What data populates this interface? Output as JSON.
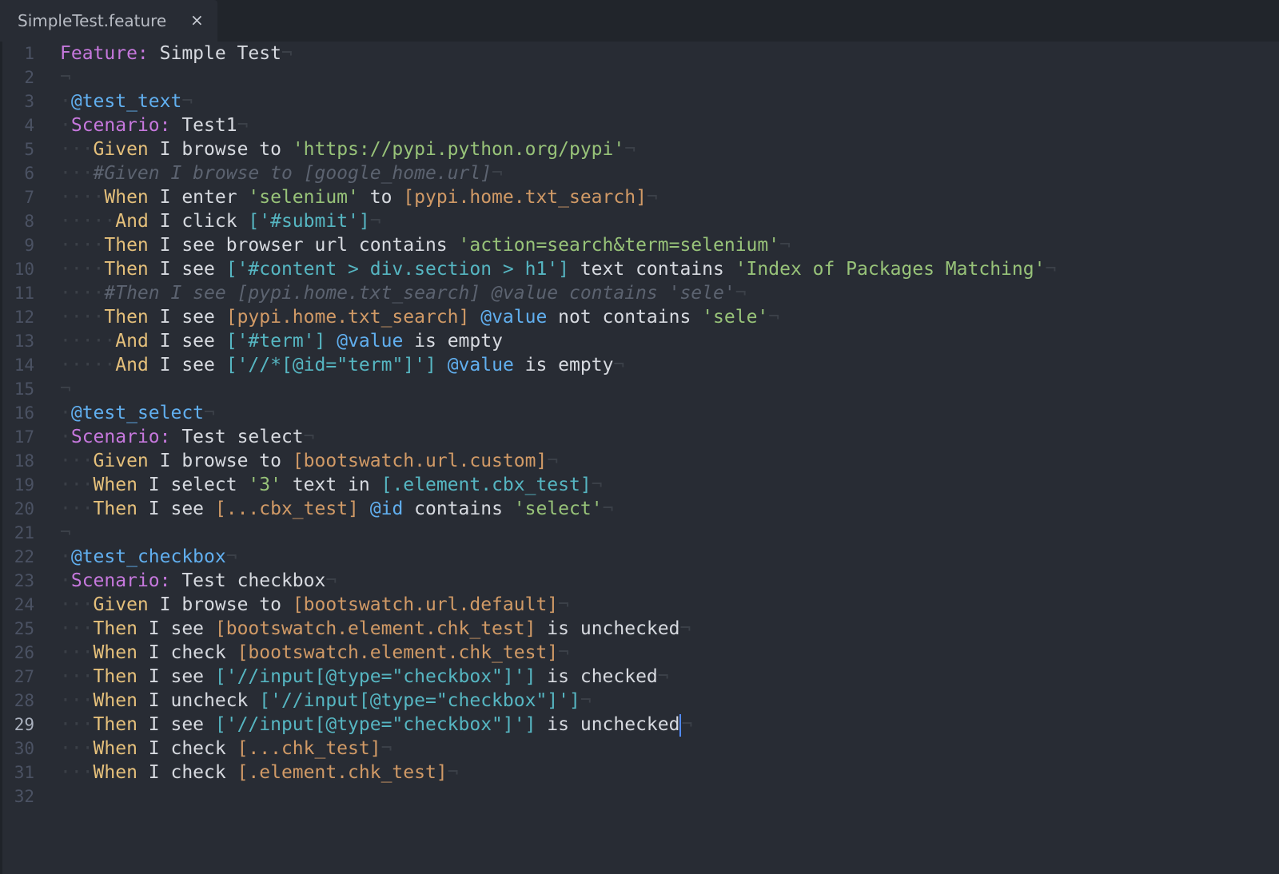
{
  "tab": {
    "title": "SimpleTest.feature",
    "close_glyph": "×"
  },
  "cursor": {
    "line": 29
  },
  "lines": [
    {
      "n": "1",
      "segs": [
        [
          "kw-feature",
          "Feature:"
        ],
        [
          "txt",
          " Simple Test"
        ],
        [
          "ws",
          "¬"
        ]
      ]
    },
    {
      "n": "2",
      "segs": [
        [
          "ws",
          "¬"
        ]
      ]
    },
    {
      "n": "3",
      "segs": [
        [
          "ws",
          "·"
        ],
        [
          "tag",
          "@test_text"
        ],
        [
          "ws",
          "¬"
        ]
      ]
    },
    {
      "n": "4",
      "segs": [
        [
          "ws",
          "·"
        ],
        [
          "kw-scenario",
          "Scenario:"
        ],
        [
          "txt",
          " Test1"
        ],
        [
          "ws",
          "¬"
        ]
      ]
    },
    {
      "n": "5",
      "segs": [
        [
          "ws",
          "···"
        ],
        [
          "kw-step",
          "Given"
        ],
        [
          "txt",
          " I browse to "
        ],
        [
          "str",
          "'https://pypi.python.org/pypi'"
        ],
        [
          "ws",
          "¬"
        ]
      ]
    },
    {
      "n": "6",
      "segs": [
        [
          "ws",
          "···"
        ],
        [
          "comment",
          "#Given I browse to [google_home.url]"
        ],
        [
          "ws",
          "¬"
        ]
      ]
    },
    {
      "n": "7",
      "segs": [
        [
          "ws",
          "····"
        ],
        [
          "kw-step",
          "When"
        ],
        [
          "txt",
          " I enter "
        ],
        [
          "str",
          "'selenium'"
        ],
        [
          "txt",
          " to "
        ],
        [
          "loc",
          "[pypi.home.txt_search]"
        ],
        [
          "ws",
          "¬"
        ]
      ]
    },
    {
      "n": "8",
      "segs": [
        [
          "ws",
          "·····"
        ],
        [
          "kw-step",
          "And"
        ],
        [
          "txt",
          " I click "
        ],
        [
          "sel",
          "['#submit']"
        ],
        [
          "ws",
          "¬"
        ]
      ]
    },
    {
      "n": "9",
      "segs": [
        [
          "ws",
          "····"
        ],
        [
          "kw-step",
          "Then"
        ],
        [
          "txt",
          " I see browser url contains "
        ],
        [
          "str",
          "'action=search&term=selenium'"
        ],
        [
          "ws",
          "¬"
        ]
      ]
    },
    {
      "n": "10",
      "segs": [
        [
          "ws",
          "····"
        ],
        [
          "kw-step",
          "Then"
        ],
        [
          "txt",
          " I see "
        ],
        [
          "sel",
          "['#content > div.section > h1']"
        ],
        [
          "txt",
          " text contains "
        ],
        [
          "str",
          "'Index of Packages Matching'"
        ],
        [
          "ws",
          "¬"
        ]
      ]
    },
    {
      "n": "11",
      "segs": [
        [
          "ws",
          "····"
        ],
        [
          "comment",
          "#Then I see [pypi.home.txt_search] @value contains 'sele'"
        ],
        [
          "ws",
          "¬"
        ]
      ]
    },
    {
      "n": "12",
      "segs": [
        [
          "ws",
          "····"
        ],
        [
          "kw-step",
          "Then"
        ],
        [
          "txt",
          " I see "
        ],
        [
          "loc",
          "[pypi.home.txt_search]"
        ],
        [
          "txt",
          " "
        ],
        [
          "attr",
          "@value"
        ],
        [
          "txt",
          " not contains "
        ],
        [
          "str",
          "'sele'"
        ],
        [
          "ws",
          "¬"
        ]
      ]
    },
    {
      "n": "13",
      "segs": [
        [
          "ws",
          "·····"
        ],
        [
          "kw-step",
          "And"
        ],
        [
          "txt",
          " I see "
        ],
        [
          "sel",
          "['#term']"
        ],
        [
          "txt",
          " "
        ],
        [
          "attr",
          "@value"
        ],
        [
          "txt",
          " is empty"
        ]
      ]
    },
    {
      "n": "14",
      "segs": [
        [
          "ws",
          "·····"
        ],
        [
          "kw-step",
          "And"
        ],
        [
          "txt",
          " I see "
        ],
        [
          "sel",
          "['//*[@id=\"term\"]']"
        ],
        [
          "txt",
          " "
        ],
        [
          "attr",
          "@value"
        ],
        [
          "txt",
          " is empty"
        ],
        [
          "ws",
          "¬"
        ]
      ]
    },
    {
      "n": "15",
      "segs": [
        [
          "ws",
          "¬"
        ]
      ]
    },
    {
      "n": "16",
      "segs": [
        [
          "ws",
          "·"
        ],
        [
          "tag",
          "@test_select"
        ],
        [
          "ws",
          "¬"
        ]
      ]
    },
    {
      "n": "17",
      "segs": [
        [
          "ws",
          "·"
        ],
        [
          "kw-scenario",
          "Scenario:"
        ],
        [
          "txt",
          " Test select"
        ],
        [
          "ws",
          "¬"
        ]
      ]
    },
    {
      "n": "18",
      "segs": [
        [
          "ws",
          "···"
        ],
        [
          "kw-step",
          "Given"
        ],
        [
          "txt",
          " I browse to "
        ],
        [
          "loc",
          "[bootswatch.url.custom]"
        ],
        [
          "ws",
          "¬"
        ]
      ]
    },
    {
      "n": "19",
      "segs": [
        [
          "ws",
          "···"
        ],
        [
          "kw-step",
          "When"
        ],
        [
          "txt",
          " I select "
        ],
        [
          "str",
          "'3'"
        ],
        [
          "txt",
          " text in "
        ],
        [
          "sel",
          "[.element.cbx_test]"
        ],
        [
          "ws",
          "¬"
        ]
      ]
    },
    {
      "n": "20",
      "segs": [
        [
          "ws",
          "···"
        ],
        [
          "kw-step",
          "Then"
        ],
        [
          "txt",
          " I see "
        ],
        [
          "loc",
          "[...cbx_test]"
        ],
        [
          "txt",
          " "
        ],
        [
          "attr",
          "@id"
        ],
        [
          "txt",
          " contains "
        ],
        [
          "str",
          "'select'"
        ],
        [
          "ws",
          "¬"
        ]
      ]
    },
    {
      "n": "21",
      "segs": [
        [
          "ws",
          "¬"
        ]
      ]
    },
    {
      "n": "22",
      "segs": [
        [
          "ws",
          "·"
        ],
        [
          "tag",
          "@test_checkbox"
        ],
        [
          "ws",
          "¬"
        ]
      ]
    },
    {
      "n": "23",
      "segs": [
        [
          "ws",
          "·"
        ],
        [
          "kw-scenario",
          "Scenario:"
        ],
        [
          "txt",
          " Test checkbox"
        ],
        [
          "ws",
          "¬"
        ]
      ]
    },
    {
      "n": "24",
      "segs": [
        [
          "ws",
          "···"
        ],
        [
          "kw-step",
          "Given"
        ],
        [
          "txt",
          " I browse to "
        ],
        [
          "loc",
          "[bootswatch.url.default]"
        ],
        [
          "ws",
          "¬"
        ]
      ]
    },
    {
      "n": "25",
      "segs": [
        [
          "ws",
          "···"
        ],
        [
          "kw-step",
          "Then"
        ],
        [
          "txt",
          " I see "
        ],
        [
          "loc",
          "[bootswatch.element.chk_test]"
        ],
        [
          "txt",
          " is unchecked"
        ],
        [
          "ws",
          "¬"
        ]
      ]
    },
    {
      "n": "26",
      "segs": [
        [
          "ws",
          "···"
        ],
        [
          "kw-step",
          "When"
        ],
        [
          "txt",
          " I check "
        ],
        [
          "loc",
          "[bootswatch.element.chk_test]"
        ],
        [
          "ws",
          "¬"
        ]
      ]
    },
    {
      "n": "27",
      "segs": [
        [
          "ws",
          "···"
        ],
        [
          "kw-step",
          "Then"
        ],
        [
          "txt",
          " I see "
        ],
        [
          "sel",
          "['//input[@type=\"checkbox\"]']"
        ],
        [
          "txt",
          " is checked"
        ],
        [
          "ws",
          "¬"
        ]
      ]
    },
    {
      "n": "28",
      "segs": [
        [
          "ws",
          "···"
        ],
        [
          "kw-step",
          "When"
        ],
        [
          "txt",
          " I uncheck "
        ],
        [
          "sel",
          "['//input[@type=\"checkbox\"]']"
        ],
        [
          "ws",
          "¬"
        ]
      ]
    },
    {
      "n": "29",
      "segs": [
        [
          "ws",
          "···"
        ],
        [
          "kw-step",
          "Then"
        ],
        [
          "txt",
          " I see "
        ],
        [
          "sel",
          "['//input[@type=\"checkbox\"]']"
        ],
        [
          "txt",
          " is unchecked"
        ],
        [
          "cursor",
          ""
        ],
        [
          "ws",
          "¬"
        ]
      ]
    },
    {
      "n": "30",
      "segs": [
        [
          "ws",
          "···"
        ],
        [
          "kw-step",
          "When"
        ],
        [
          "txt",
          " I check "
        ],
        [
          "loc",
          "[...chk_test]"
        ],
        [
          "ws",
          "¬"
        ]
      ]
    },
    {
      "n": "31",
      "segs": [
        [
          "ws",
          "···"
        ],
        [
          "kw-step",
          "When"
        ],
        [
          "txt",
          " I check "
        ],
        [
          "loc",
          "[.element.chk_test]"
        ],
        [
          "ws",
          "¬"
        ]
      ]
    },
    {
      "n": "32",
      "segs": []
    }
  ]
}
